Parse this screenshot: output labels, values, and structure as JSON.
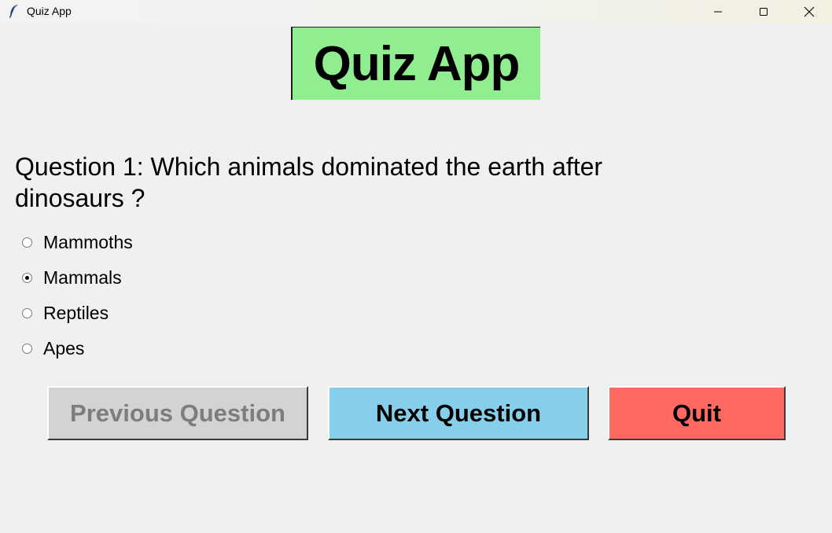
{
  "window": {
    "title": "Quiz App",
    "icon": "feather-icon",
    "controls": [
      "minimize-icon",
      "maximize-icon",
      "close-icon"
    ]
  },
  "app": {
    "heading": "Quiz App",
    "heading_bg": "#90ee90"
  },
  "question": {
    "text": "Question 1: Which animals dominated the earth after dinosaurs ?"
  },
  "options": [
    {
      "label": "Mammoths",
      "selected": false
    },
    {
      "label": "Mammals",
      "selected": true
    },
    {
      "label": "Reptiles",
      "selected": false
    },
    {
      "label": "Apes",
      "selected": false
    }
  ],
  "buttons": {
    "previous": {
      "label": "Previous Question",
      "bg": "#d3d3d3",
      "enabled": false
    },
    "next": {
      "label": "Next Question",
      "bg": "#87ceeb",
      "enabled": true
    },
    "quit": {
      "label": "Quit",
      "bg": "#ff6961",
      "enabled": true
    }
  }
}
